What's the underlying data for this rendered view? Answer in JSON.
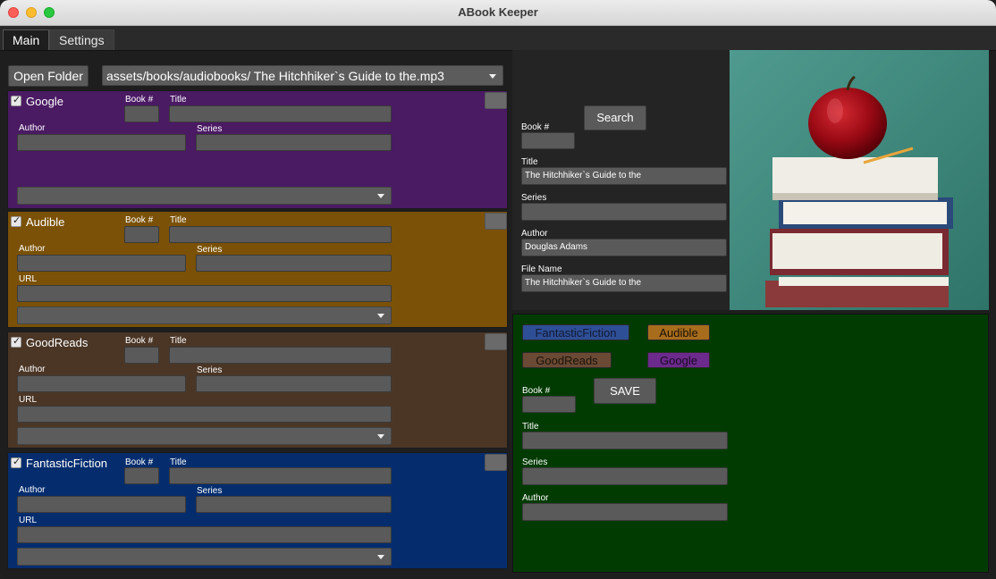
{
  "window": {
    "title": "ABook Keeper"
  },
  "tabs": {
    "main": "Main",
    "settings": "Settings"
  },
  "toolbar": {
    "open_folder": "Open Folder",
    "path": "assets/books/audiobooks/ The Hitchhiker`s Guide to the.mp3"
  },
  "sources": {
    "google": {
      "name": "Google",
      "color": "#4a1a63"
    },
    "audible": {
      "name": "Audible",
      "color": "#7a5106"
    },
    "goodreads": {
      "name": "GoodReads",
      "color": "#4b3626"
    },
    "fantasticfiction": {
      "name": "FantasticFiction",
      "color": "#052d6e"
    }
  },
  "labels": {
    "book_num": "Book #",
    "title": "Title",
    "author": "Author",
    "series": "Series",
    "url": "URL",
    "file_name": "File Name"
  },
  "search": {
    "button": "Search",
    "title_value": "The Hitchhiker`s Guide to the",
    "series_value": "",
    "author_value": "Douglas Adams",
    "file_name_value": "The Hitchhiker`s Guide to the"
  },
  "save_panel": {
    "chips": {
      "fantasticfiction": "FantasticFiction",
      "audible": "Audible",
      "goodreads": "GoodReads",
      "google": "Google"
    },
    "save": "SAVE"
  }
}
